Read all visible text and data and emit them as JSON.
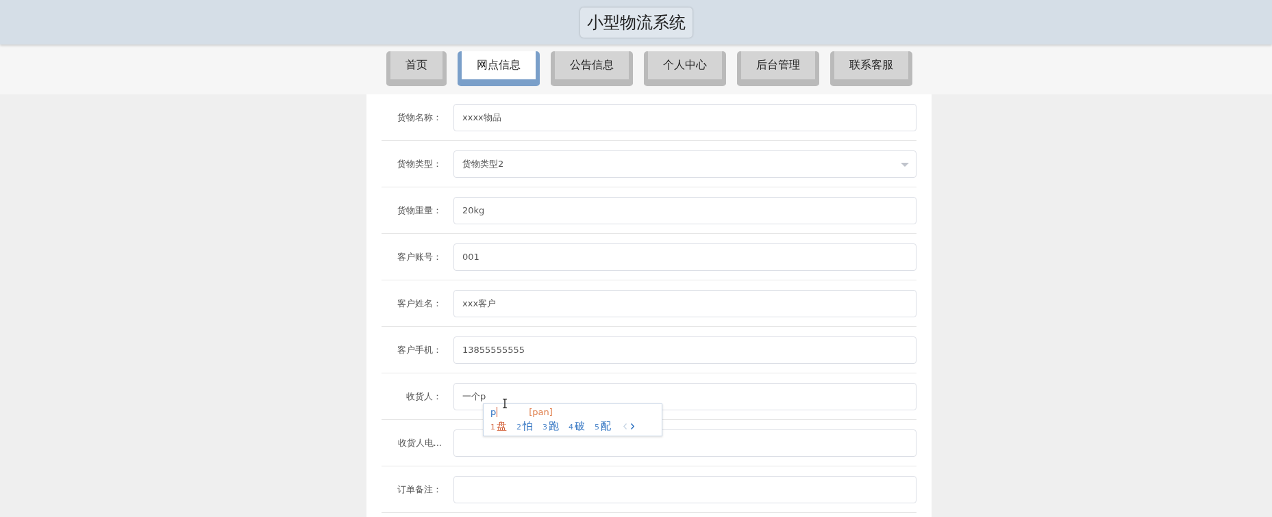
{
  "header": {
    "title": "小型物流系统"
  },
  "nav": [
    {
      "label": "首页",
      "selected": false
    },
    {
      "label": "网点信息",
      "selected": true
    },
    {
      "label": "公告信息",
      "selected": false
    },
    {
      "label": "个人中心",
      "selected": false
    },
    {
      "label": "后台管理",
      "selected": false
    },
    {
      "label": "联系客服",
      "selected": false
    }
  ],
  "form": {
    "fields": [
      {
        "label": "货物名称：",
        "kind": "input",
        "value": "xxxx物品"
      },
      {
        "label": "货物类型：",
        "kind": "select",
        "value": "货物类型2"
      },
      {
        "label": "货物重量：",
        "kind": "input",
        "value": "20kg"
      },
      {
        "label": "客户账号：",
        "kind": "input",
        "value": "001"
      },
      {
        "label": "客户姓名：",
        "kind": "input",
        "value": "xxx客户"
      },
      {
        "label": "客户手机：",
        "kind": "input",
        "value": "13855555555"
      },
      {
        "label": "收货人：",
        "kind": "input",
        "value": "一个p",
        "ime": {
          "composition": "p",
          "pinyin": "[pan]",
          "candidates": [
            {
              "index": "1",
              "text": "盘",
              "selected": true
            },
            {
              "index": "2",
              "text": "怕",
              "selected": false
            },
            {
              "index": "3",
              "text": "跑",
              "selected": false
            },
            {
              "index": "4",
              "text": "破",
              "selected": false
            },
            {
              "index": "5",
              "text": "配",
              "selected": false
            }
          ]
        }
      },
      {
        "label": "收货人电...",
        "kind": "input"
      },
      {
        "label": "订单备注：",
        "kind": "input"
      }
    ]
  }
}
